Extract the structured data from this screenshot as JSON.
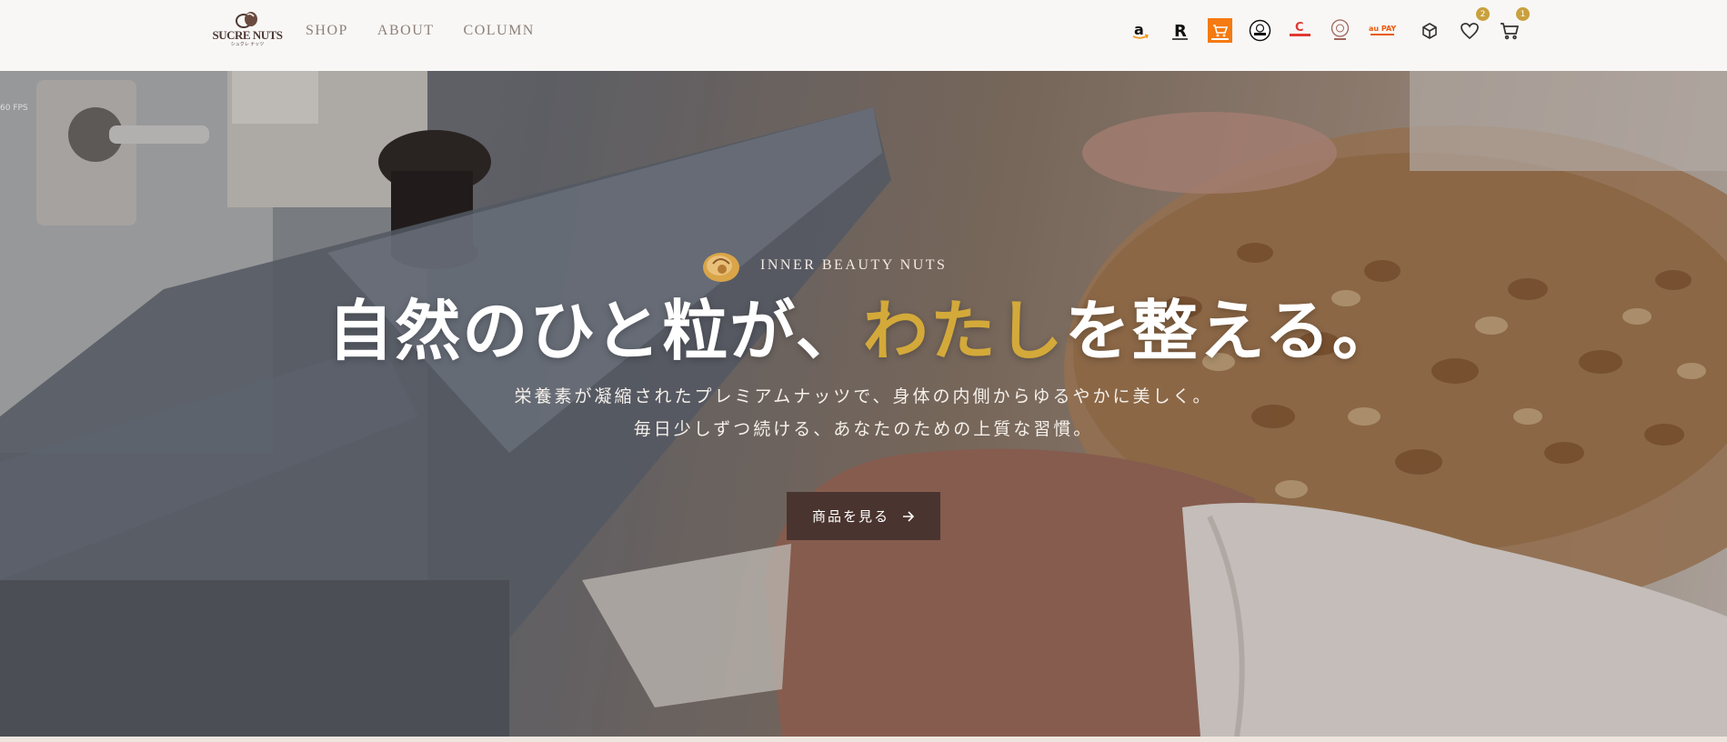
{
  "brand": {
    "logo_text": "SUCRE NUTS",
    "logo_sub": "シュクレ ナッツ"
  },
  "nav": [
    {
      "label": "SHOP"
    },
    {
      "label": "ABOUT"
    },
    {
      "label": "COLUMN"
    }
  ],
  "marketplaces": [
    {
      "name": "amazon",
      "icon": "amazon-icon"
    },
    {
      "name": "rakuten",
      "icon": "rakuten-icon"
    },
    {
      "name": "yahoo-shopping",
      "icon": "shopping-cart-store-icon"
    },
    {
      "name": "store-circle",
      "icon": "circle-logo-icon"
    },
    {
      "name": "creema",
      "icon": "creema-icon"
    },
    {
      "name": "round-seal",
      "icon": "seal-logo-icon"
    },
    {
      "name": "au-pay-market",
      "icon": "au-pay-icon"
    }
  ],
  "header_icons": {
    "box_icon": "box-icon",
    "wishlist_icon": "heart-icon",
    "wishlist_count": "2",
    "cart_icon": "cart-icon",
    "cart_count": "1"
  },
  "hero": {
    "fps": "60 FPS",
    "eyebrow": "INNER BEAUTY NUTS",
    "headline_pre": "自然のひと粒が、",
    "headline_accent": "わたし",
    "headline_post": "を整える。",
    "lead_line1": "栄養素が凝縮されたプレミアムナッツで、身体の内側からゆるやかに美しく。",
    "lead_line2": "毎日少しずつ続ける、あなたのための上質な習慣。",
    "cta_label": "商品を見る",
    "cta_icon": "arrow-right-icon"
  },
  "colors": {
    "accent": "#d3a93a",
    "cta_bg": "#4a342f",
    "badge": "#c9a13c",
    "nav_text": "#8e8178"
  }
}
